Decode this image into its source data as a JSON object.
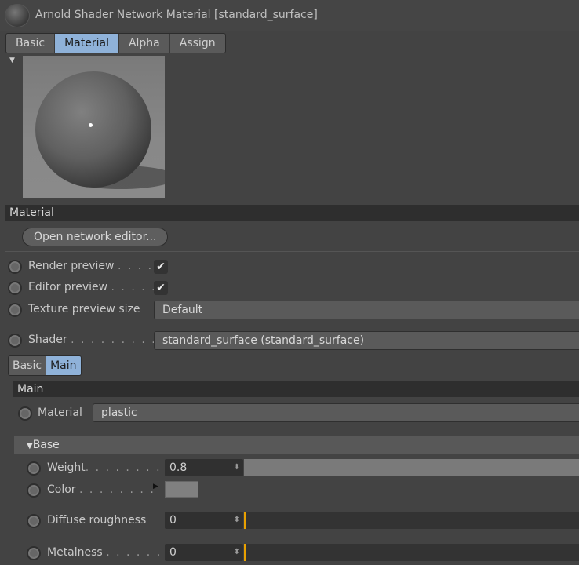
{
  "title": "Arnold Shader Network Material [standard_surface]",
  "tabs": [
    "Basic",
    "Material",
    "Alpha",
    "Assign"
  ],
  "material_section": {
    "header": "Material",
    "open_editor": "Open network editor...",
    "render_preview": {
      "label": "Render preview",
      "dots": ". . . .",
      "checked": true,
      "check": "✔"
    },
    "editor_preview": {
      "label": "Editor preview",
      "dots": ". . . . .",
      "checked": true,
      "check": "✔"
    },
    "texture_preview_size": {
      "label": "Texture preview size",
      "value": "Default"
    },
    "shader": {
      "label": "Shader",
      "dots": ". . . . . . . . . . .",
      "value": "standard_surface (standard_surface)"
    }
  },
  "subtabs": [
    "Basic",
    "Main"
  ],
  "main": {
    "header": "Main",
    "material": {
      "label": "Material",
      "value": "plastic"
    },
    "base": {
      "header": "Base",
      "weight": {
        "label": "Weight",
        "dots": ". . . . . . . . . .",
        "value": "0.8",
        "fraction": 0.8
      },
      "color": {
        "label": "Color",
        "dots": ". . . . . . . .",
        "swatch": "#808080"
      },
      "diffuse_roughness": {
        "label": "Diffuse roughness",
        "value": "0",
        "fraction": 0
      },
      "metalness": {
        "label": "Metalness",
        "dots": ". . . . . . .",
        "value": "0",
        "fraction": 0
      }
    }
  }
}
